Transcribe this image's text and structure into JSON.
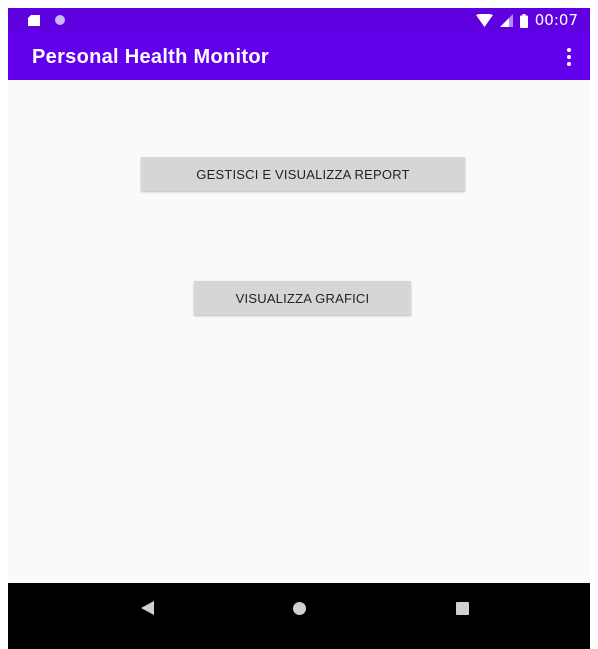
{
  "status_bar": {
    "time": "00:07",
    "icons": [
      "sd-card-icon",
      "notification-dot-icon",
      "wifi-icon",
      "signal-icon",
      "battery-icon"
    ]
  },
  "app_bar": {
    "title": "Personal Health Monitor",
    "overflow_icon": "more-vert-icon"
  },
  "main": {
    "buttons": [
      {
        "label": "GESTISCI E VISUALIZZA REPORT"
      },
      {
        "label": "VISUALIZZA GRAFICI"
      }
    ]
  },
  "nav_bar": {
    "icons": [
      "back-icon",
      "home-icon",
      "recents-icon"
    ]
  },
  "colors": {
    "status_bar": "#5f00e0",
    "app_bar": "#6200ee",
    "background": "#fafafa",
    "button": "#d6d6d6",
    "nav_bar": "#000000"
  }
}
